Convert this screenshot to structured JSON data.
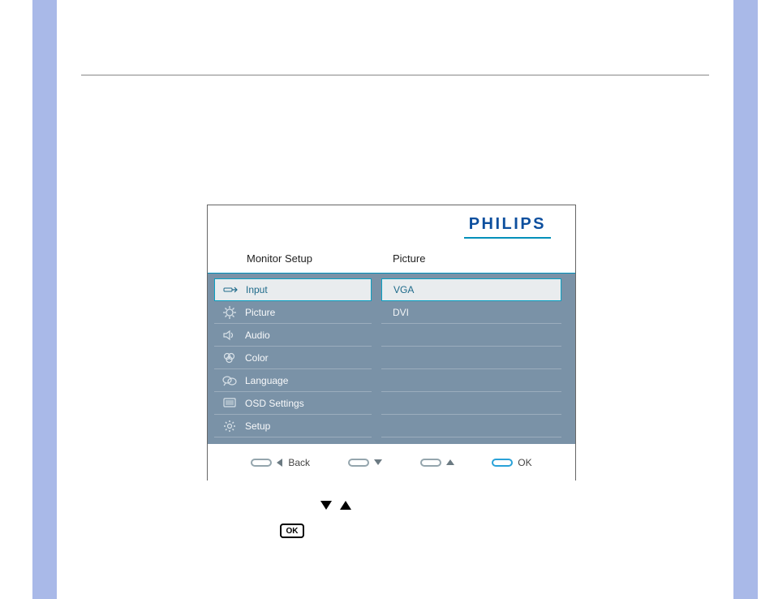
{
  "brand": "PHILIPS",
  "columnHeaders": {
    "left": "Monitor Setup",
    "right": "Picture"
  },
  "leftMenu": [
    {
      "label": "Input",
      "selected": true,
      "icon": "input-icon"
    },
    {
      "label": "Picture",
      "selected": false,
      "icon": "picture-icon"
    },
    {
      "label": "Audio",
      "selected": false,
      "icon": "audio-icon"
    },
    {
      "label": "Color",
      "selected": false,
      "icon": "color-icon"
    },
    {
      "label": "Language",
      "selected": false,
      "icon": "language-icon"
    },
    {
      "label": "OSD Settings",
      "selected": false,
      "icon": "osd-settings-icon"
    },
    {
      "label": "Setup",
      "selected": false,
      "icon": "setup-icon"
    }
  ],
  "rightMenu": [
    {
      "label": "VGA",
      "selected": true
    },
    {
      "label": "DVI",
      "selected": false
    },
    {
      "label": "",
      "selected": false
    },
    {
      "label": "",
      "selected": false
    },
    {
      "label": "",
      "selected": false
    },
    {
      "label": "",
      "selected": false
    },
    {
      "label": "",
      "selected": false
    }
  ],
  "footer": {
    "back": "Back",
    "ok": "OK"
  },
  "okBoxLabel": "OK"
}
